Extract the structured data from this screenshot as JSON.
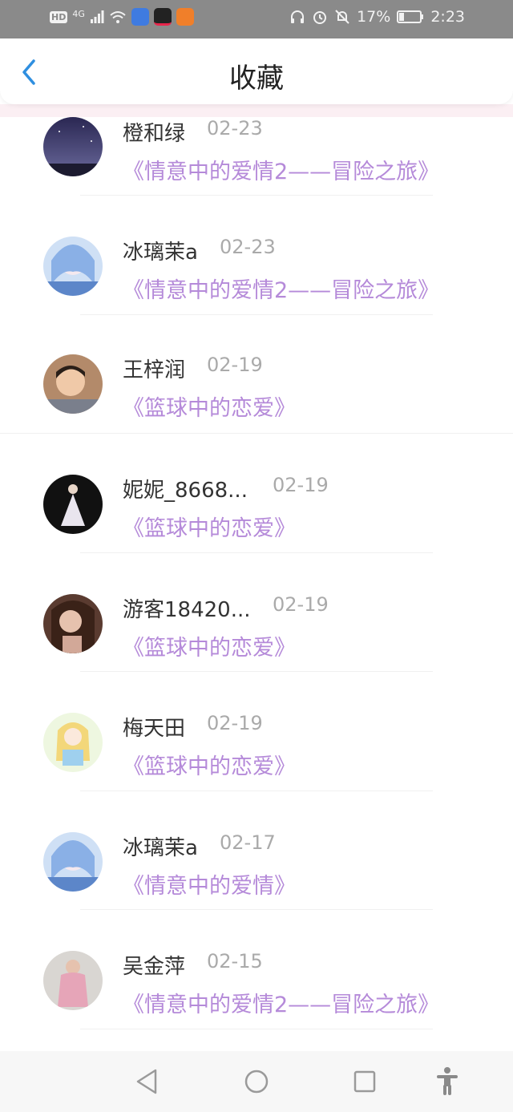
{
  "status_bar": {
    "hd": "HD",
    "network": "4G",
    "battery": "17%",
    "time": "2:23"
  },
  "header": {
    "title": "收藏"
  },
  "items": [
    {
      "name": "橙和绿",
      "date": "02-23",
      "title": "《情意中的爱情2——冒险之旅》"
    },
    {
      "name": "冰璃茉a",
      "date": "02-23",
      "title": "《情意中的爱情2——冒险之旅》"
    },
    {
      "name": "王梓润",
      "date": "02-19",
      "title": "《篮球中的恋爱》"
    },
    {
      "name": "妮妮_8668...",
      "date": "02-19",
      "title": "《篮球中的恋爱》"
    },
    {
      "name": "游客18420...",
      "date": "02-19",
      "title": "《篮球中的恋爱》"
    },
    {
      "name": "梅天田",
      "date": "02-19",
      "title": "《篮球中的恋爱》"
    },
    {
      "name": "冰璃茉a",
      "date": "02-17",
      "title": "《情意中的爱情》"
    },
    {
      "name": "吴金萍",
      "date": "02-15",
      "title": "《情意中的爱情2——冒险之旅》"
    }
  ],
  "colors": {
    "accent": "#2f8fe0",
    "title_purple": "#b58ad9",
    "status_bar": "#8a8a8a"
  }
}
